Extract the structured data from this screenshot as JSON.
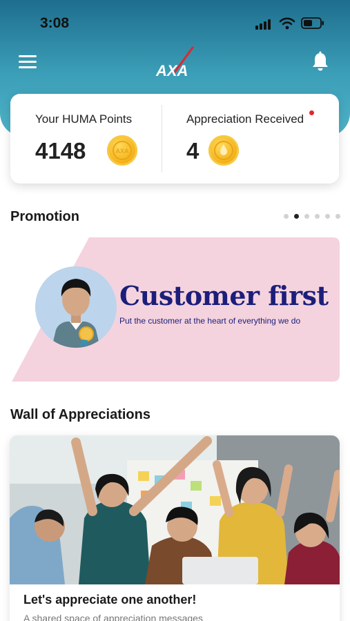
{
  "status_bar": {
    "time": "3:08"
  },
  "header": {
    "logo_text": "AXA",
    "icons": [
      "menu-icon",
      "bell-icon"
    ]
  },
  "points_card": {
    "huma_points_label": "Your HUMA Points",
    "huma_points_value": "4148",
    "appreciation_label": "Appreciation Received",
    "appreciation_value": "4",
    "coin_text": "AXA"
  },
  "promotion": {
    "title": "Promotion",
    "carousel_total": 6,
    "carousel_active_index": 1,
    "banner": {
      "heading": "Customer first",
      "subtext": "Put the customer at the heart of everything we do"
    }
  },
  "wall": {
    "title": "Wall of Appreciations",
    "card_title": "Let's appreciate one another!",
    "card_description": "A shared space of appreciation messages"
  },
  "colors": {
    "header_top": "#1e6e8e",
    "header_bottom": "#4fb3c8",
    "banner_pink": "#f4d3de",
    "banner_navy": "#1c1e7a",
    "coin_gold": "#f5b31b",
    "notification_red": "#e3262d"
  }
}
